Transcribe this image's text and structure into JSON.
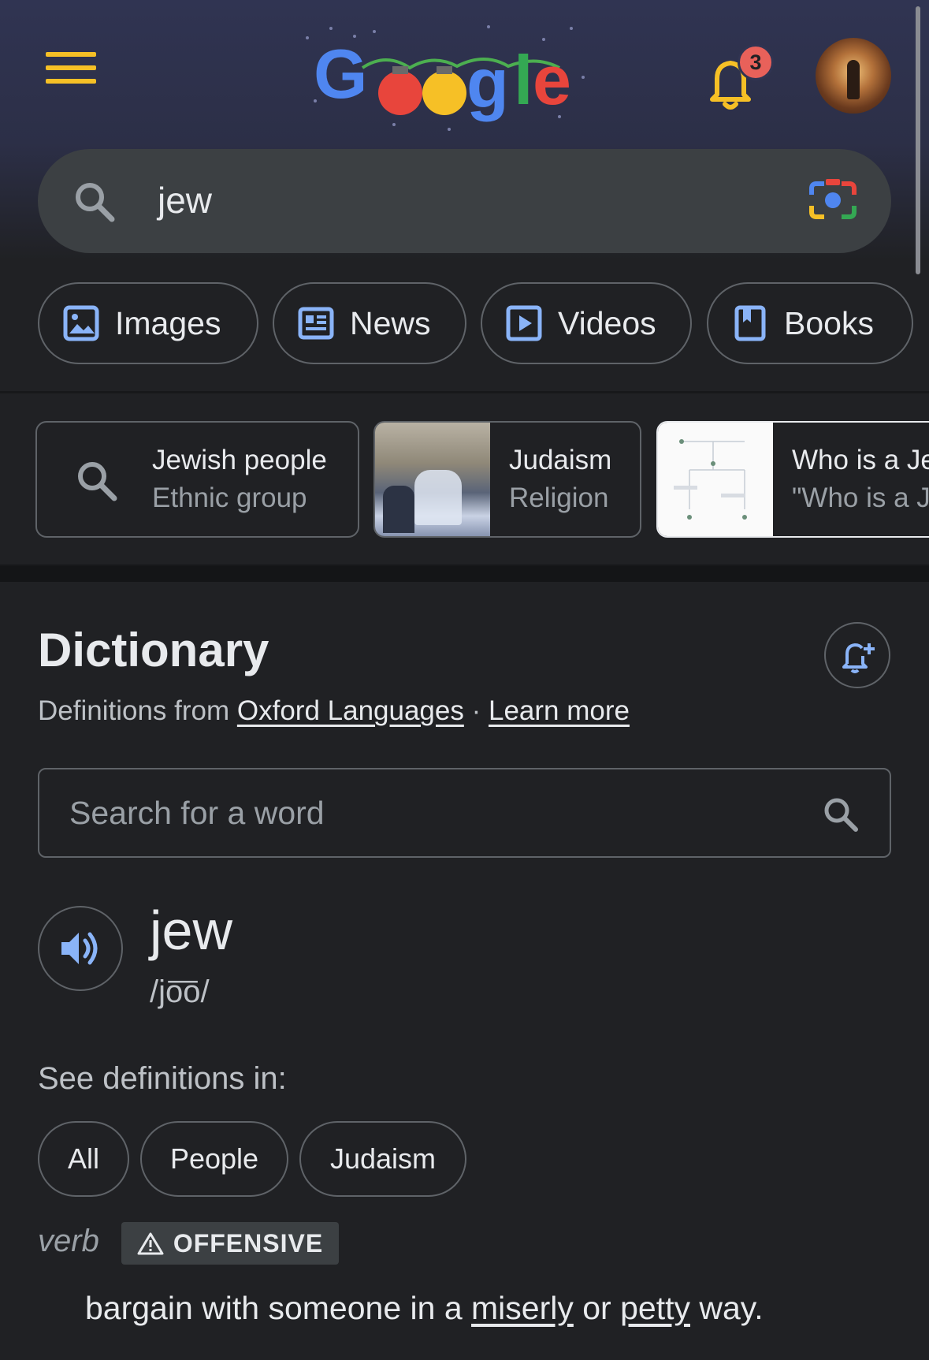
{
  "colors": {
    "background": "#202124",
    "accent_yellow": "#f6c026",
    "badge": "#e8615a",
    "link_blue": "#8ab4f8"
  },
  "header": {
    "menu_icon": "hamburger-menu-icon",
    "logo_text": "Google",
    "notifications": {
      "icon": "bell-icon",
      "count": "3"
    },
    "avatar_icon": "account-avatar"
  },
  "search": {
    "query": "jew",
    "search_icon": "search-icon",
    "lens_icon": "google-lens-camera-icon"
  },
  "filter_chips": [
    {
      "label": "Images",
      "icon": "image-icon"
    },
    {
      "label": "News",
      "icon": "newspaper-icon"
    },
    {
      "label": "Videos",
      "icon": "play-icon"
    },
    {
      "label": "Books",
      "icon": "book-icon"
    }
  ],
  "related": [
    {
      "title": "Jewish people",
      "subtitle": "Ethnic group",
      "icon": "search-icon"
    },
    {
      "title": "Judaism",
      "subtitle": "Religion",
      "icon": "thumbnail-photo"
    },
    {
      "title": "Who is a Je",
      "subtitle": "\"Who is a J",
      "icon": "thumbnail-diagram"
    }
  ],
  "dictionary": {
    "title": "Dictionary",
    "follow_icon": "bell-plus-icon",
    "source_prefix": "Definitions from",
    "source_link": "Oxford Languages",
    "separator": "·",
    "learn_more": "Learn more",
    "search_placeholder": "Search for a word",
    "headword": "jew",
    "phonetic": "/jo͞o/",
    "speaker_icon": "speaker-icon",
    "see_definitions_label": "See definitions in:",
    "sense_pills": [
      "All",
      "People",
      "Judaism"
    ],
    "part_of_speech": "verb",
    "label_tag": "OFFENSIVE",
    "warning_icon": "warning-triangle-icon",
    "definition": {
      "part1": "bargain with someone in a ",
      "link1": "miserly",
      "part2": " or ",
      "link2": "petty",
      "part3": " way."
    }
  }
}
